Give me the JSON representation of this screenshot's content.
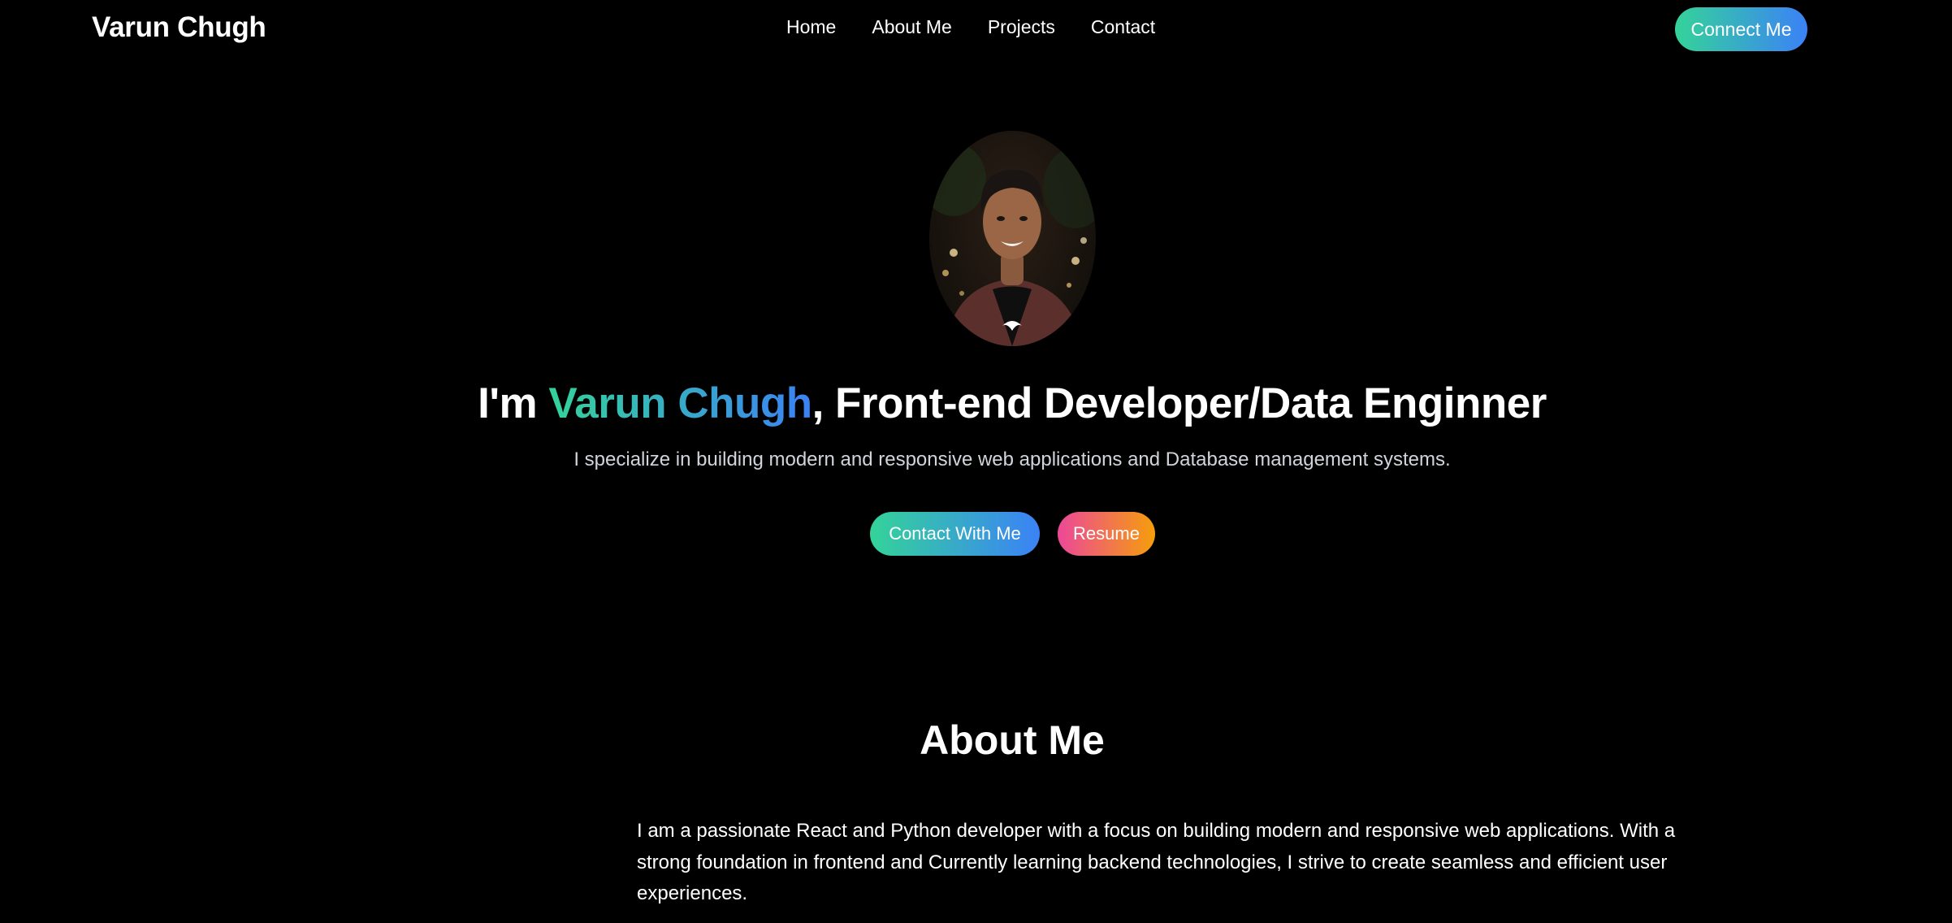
{
  "navbar": {
    "logo": "Varun Chugh",
    "links": [
      "Home",
      "About Me",
      "Projects",
      "Contact"
    ],
    "cta_label": "Connect Me"
  },
  "hero": {
    "avatar_alt": "profile-photo",
    "title_prefix": "I'm ",
    "title_name": "Varun Chugh",
    "title_suffix": ", Front-end Developer/Data Enginner",
    "subtitle": "I specialize in building modern and responsive web applications and Database management systems.",
    "contact_button": "Contact With Me",
    "resume_button": "Resume"
  },
  "about": {
    "heading": "About Me",
    "body": "I am a passionate React and Python developer with a focus on building modern and responsive web applications. With a strong foundation in frontend and Currently learning backend technologies, I strive to create seamless and efficient user experiences."
  },
  "colors": {
    "background": "#000000",
    "accent_gradient_start": "#34d399",
    "accent_gradient_end": "#3b82f6",
    "resume_gradient_start": "#ec4899",
    "resume_gradient_end": "#f59e0b",
    "subtitle_text": "#d1d5db"
  }
}
